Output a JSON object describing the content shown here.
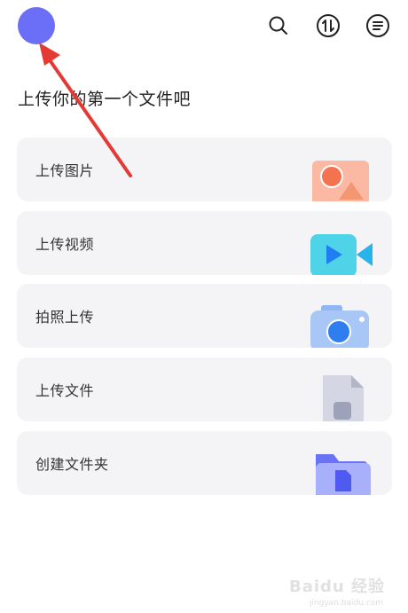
{
  "header": {
    "avatar": "avatar",
    "icons": [
      "search-icon",
      "transfer-icon",
      "menu-icon"
    ]
  },
  "page_title": "上传你的第一个文件吧",
  "cards": [
    {
      "label": "上传图片",
      "icon": "image-upload-icon"
    },
    {
      "label": "上传视频",
      "icon": "video-upload-icon"
    },
    {
      "label": "拍照上传",
      "icon": "camera-upload-icon"
    },
    {
      "label": "上传文件",
      "icon": "file-upload-icon"
    },
    {
      "label": "创建文件夹",
      "icon": "folder-create-icon"
    }
  ],
  "watermark": {
    "brand": "Baidu 经验",
    "sub": "jingyan.baidu.com"
  },
  "colors": {
    "accent": "#6b6ef6",
    "annotation_arrow": "#e53935",
    "card_bg": "#f4f4f6"
  }
}
